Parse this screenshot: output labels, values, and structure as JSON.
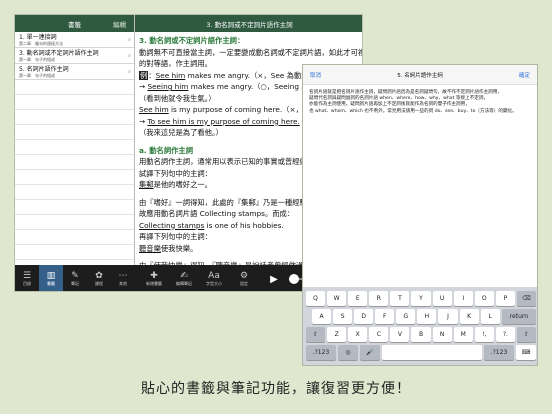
{
  "sidebar": {
    "title": "書籤",
    "edit_label": "編輯",
    "items": [
      {
        "title": "1. 單一連接詞",
        "sub": "第二章　複句的連接方法"
      },
      {
        "title": "3. 動名詞或不定詞片語作主詞",
        "sub": "第一章　句子的組成"
      },
      {
        "title": "5. 名詞片語作主詞",
        "sub": "第一章　句子的組成"
      }
    ]
  },
  "main": {
    "title": "3. 動名詞或不定詞片語作主詞",
    "lines": [
      {
        "text": "3. 動名詞或不定詞片語作主詞：",
        "cls": "h"
      },
      {
        "text": "動詞無不可直接當主詞，一定要變成動名詞或不定詞片語，如此才可視為名詞",
        "cls": ""
      },
      {
        "text": "的對等語，作主詞用。",
        "cls": ""
      },
      {
        "mark": "例",
        "pre": "：",
        "u": "See him",
        "post": " makes me angry.（×，See 為動詞）"
      },
      {
        "pre": "→ ",
        "u": "Seeing him",
        "post": " makes me angry.（○，Seeing 為動名"
      },
      {
        "text": "（看到他就令我生氣。）",
        "cls": ""
      },
      {
        "u": "See him",
        "post": " is my purpose of coming here.（×，"
      },
      {
        "pre": "→ ",
        "u": "To see him is my purpose of coming here.",
        "post": "（○，To"
      },
      {
        "text": "（我來這兒是為了看他。）",
        "cls": ""
      },
      {
        "text": "",
        "cls": ""
      },
      {
        "text": "a. 動名詞作主詞",
        "cls": "h"
      },
      {
        "text": "用動名詞作主詞，通常用以表示已知的事實或曾經做過的事。",
        "cls": ""
      },
      {
        "text": "試譯下列句中的主詞：",
        "cls": ""
      },
      {
        "u": "集郵",
        "post": "是他的嗜好之一。"
      },
      {
        "text": "",
        "cls": ""
      },
      {
        "text": "由『嗜好』一詞得知，此處的『集郵』乃是一種經驗，",
        "cls": ""
      },
      {
        "text": "故應用動名詞片語 Collecting stamps。而成：",
        "cls": ""
      },
      {
        "u": "Collecting stamps",
        "post": " is one of his hobbies."
      },
      {
        "text": "再譯下列句中的主詞：",
        "cls": ""
      },
      {
        "u": "聽音樂",
        "post": "使我快樂。"
      },
      {
        "text": "",
        "cls": ""
      },
      {
        "text": "由『使我快樂』得知，『聽音樂』是說話者曾經做過的事，",
        "cls": ""
      }
    ]
  },
  "tabbar": {
    "left_tabs": [
      {
        "icon": "☰",
        "label": "目錄"
      },
      {
        "icon": "▥",
        "label": "書籤"
      },
      {
        "icon": "✎",
        "label": "筆記"
      },
      {
        "icon": "✿",
        "label": "課程"
      },
      {
        "icon": "⋯",
        "label": "其他"
      }
    ],
    "right_tabs": [
      {
        "icon": "✚",
        "label": "新增書籤"
      },
      {
        "icon": "✍",
        "label": "編輯筆記"
      },
      {
        "icon": "Aa",
        "label": "字型大小"
      },
      {
        "icon": "⚙",
        "label": "設定"
      }
    ],
    "play_icon": "▶"
  },
  "note": {
    "cancel": "取消",
    "title": "5. 名詞片語作主詞",
    "done": "確定",
    "lines": [
      "名詞片語就是把名詞片語作主詞，疑問詞片語因為是名詞疑問句，故不作不定詞片語作主詞用，",
      "疑問代名詞與疑問副詞的名詞片語 when、where、how、why、what 等接上不定詞，",
      "亦能作為主詞使用。疑問詞片語再加上不定詞後就能作為名詞的雙子作主詞用，",
      "也 what、whom、which 也不例外。常見用法請用一些的詞 do、see、buy、to（方法等）的變化。"
    ]
  },
  "keyboard": {
    "row1": [
      "Q",
      "W",
      "E",
      "R",
      "T",
      "Y",
      "U",
      "I",
      "O",
      "P",
      "⌫"
    ],
    "row2": [
      "A",
      "S",
      "D",
      "F",
      "G",
      "H",
      "J",
      "K",
      "L",
      "return"
    ],
    "row3": [
      "⇧",
      "Z",
      "X",
      "C",
      "V",
      "B",
      "N",
      "M",
      "!,",
      "?.",
      "⇧"
    ],
    "row4": [
      ".?123",
      "◎",
      "🎤",
      "",
      ".?123",
      "⌨"
    ]
  },
  "caption": "貼心的書籤與筆記功能，讓復習更方便！",
  "colors": {
    "header_green": "#2f5a40",
    "tab_selected": "#34608a",
    "accent_text_green": "#2a7a3a",
    "link_blue": "#2a6fd6",
    "background": "#dfe8cf"
  }
}
